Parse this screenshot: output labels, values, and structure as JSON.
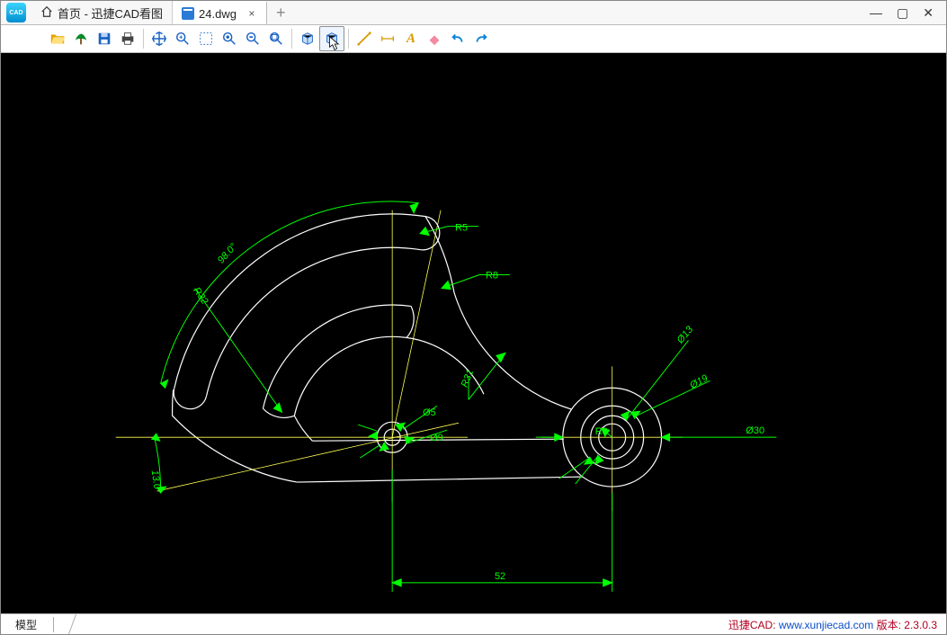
{
  "window": {
    "minimize_glyph": "—",
    "maximize_glyph": "▢",
    "close_glyph": "✕"
  },
  "tabs": {
    "home_label": "首页 - 迅捷CAD看图",
    "file_label": "24.dwg",
    "close_glyph": "×",
    "new_glyph": "+"
  },
  "toolbar": {
    "items": [
      "open",
      "tree",
      "save",
      "print",
      "|",
      "pan",
      "zoom-window",
      "area",
      "zoom-in",
      "zoom-out",
      "zoom-extents",
      "|",
      "view-cube",
      "3d-cube",
      "|",
      "measure",
      "dimension",
      "text",
      "erase",
      "undo",
      "redo"
    ]
  },
  "status": {
    "model_tab": "模型",
    "brand": "迅捷CAD:",
    "url": "www.xunjiecad.com",
    "version_label": "版本:",
    "version": "2.3.0.3"
  },
  "drawing": {
    "dims": {
      "angle1": "98.0°",
      "angle2": "13.0°",
      "r32": "R32",
      "r5": "R5",
      "r8_top": "R8",
      "r31": "R31",
      "d5": "Ø5",
      "d9": "Ø9",
      "d13": "Ø13",
      "d19": "Ø19",
      "d30": "Ø30",
      "r8_right": "R8",
      "span52": "52"
    }
  }
}
